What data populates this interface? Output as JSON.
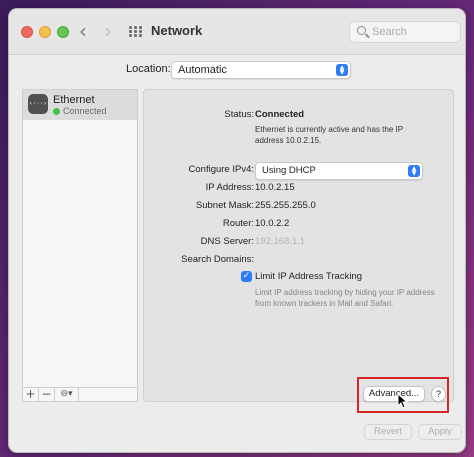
{
  "window": {
    "title": "Network",
    "search_placeholder": "Search",
    "nav_back": "‹",
    "nav_forward": "›"
  },
  "location": {
    "label": "Location:",
    "value": "Automatic"
  },
  "sidebar": {
    "services": [
      {
        "name": "Ethernet",
        "status": "Connected",
        "icon": "ethernet-icon",
        "icon_glyph": "‹···›",
        "status_color": "#3fc24a"
      }
    ],
    "footer": {
      "add": "+",
      "remove": "−",
      "action": "⊖▾"
    }
  },
  "details": {
    "status_label": "Status:",
    "status_value": "Connected",
    "status_note_line1": "Ethernet is currently active and has the IP",
    "status_note_line2": "address 10.0.2.15.",
    "configure_label": "Configure IPv4:",
    "configure_value": "Using DHCP",
    "ip_label": "IP Address:",
    "ip_value": "10.0.2.15",
    "subnet_label": "Subnet Mask:",
    "subnet_value": "255.255.255.0",
    "router_label": "Router:",
    "router_value": "10.0.2.2",
    "dns_label": "DNS Server:",
    "dns_value": "192.168.1.1",
    "search_domains_label": "Search Domains:",
    "limit_tracking_label": "Limit IP Address Tracking",
    "limit_tracking_checked": true,
    "limit_note_line1": "Limit IP address tracking by hiding your IP address",
    "limit_note_line2": "from known trackers in Mail and Safari."
  },
  "buttons": {
    "advanced": "Advanced...",
    "help": "?",
    "revert": "Revert",
    "apply": "Apply"
  },
  "colors": {
    "accent": "#2f7cf6",
    "highlight": "#d6262a",
    "connected": "#3fc24a"
  }
}
